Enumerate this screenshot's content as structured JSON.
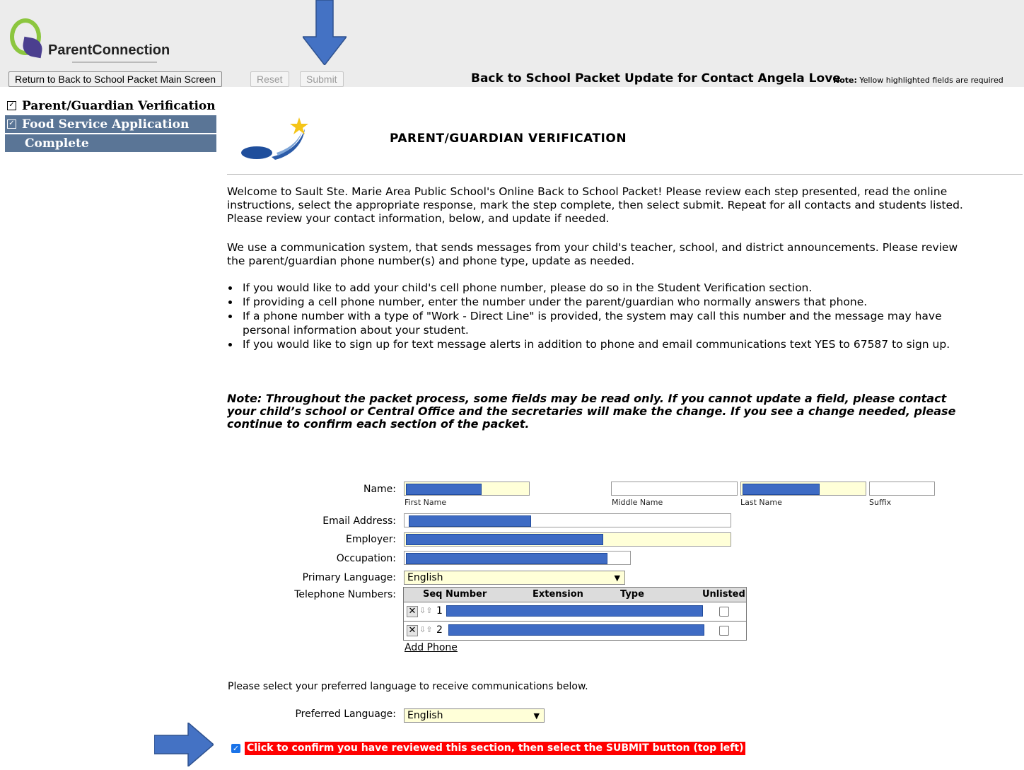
{
  "app": {
    "logo_text": "ParentConnection"
  },
  "toolbar": {
    "return_label": "Return to Back to School Packet Main Screen",
    "reset_label": "Reset",
    "submit_label": "Submit"
  },
  "header": {
    "title": "Back to School Packet Update for Contact Angela Love",
    "note_label": "Note:",
    "note_text": " Yellow highlighted fields are required"
  },
  "sidebar": {
    "items": [
      {
        "label": "Parent/Guardian Verification",
        "checked": true
      },
      {
        "label": "Food Service Application",
        "checked": true
      },
      {
        "label": "Complete",
        "checked": false
      }
    ]
  },
  "main": {
    "page_title": "PARENT/GUARDIAN VERIFICATION",
    "intro": "Welcome to Sault Ste. Marie Area Public School's Online Back to School Packet! Please review each step presented, read the online instructions, select the appropriate response, mark the step complete, then select submit. Repeat for all contacts and students listed. Please review your contact information, below, and update if needed.",
    "comm_para": "We use a communication system, that sends messages from your child's teacher, school, and district announcements. Please review the parent/guardian phone number(s) and phone type, update as needed.",
    "bullets": [
      "If you would like to add your child's cell phone number, please do so in the Student Verification section.",
      "If providing a cell phone number, enter the number under the parent/guardian who normally answers that phone.",
      "If a phone number with a type of \"Work - Direct Line\" is provided, the system may call this number and the message may have personal information about your student.",
      "If you would like to sign up for text message alerts in addition to phone and email communications text YES to 67587 to sign up."
    ],
    "note": "Note: Throughout the packet process, some fields may be read only. If you cannot update a field, please contact your child’s school or Central Office and the secretaries will make the change. If you see a change needed, please continue to confirm each section of the packet."
  },
  "form": {
    "name_label": "Name:",
    "first_name_caption": "First Name",
    "middle_name_caption": "Middle Name",
    "last_name_caption": "Last Name",
    "suffix_caption": "Suffix",
    "email_label": "Email Address:",
    "employer_label": "Employer:",
    "occupation_label": "Occupation:",
    "primary_language_label": "Primary Language:",
    "primary_language_value": "English",
    "telephone_label": "Telephone Numbers:",
    "phone_columns": [
      "Seq Number",
      "Extension",
      "Type",
      "Unlisted"
    ],
    "phone_rows": [
      {
        "seq": "1"
      },
      {
        "seq": "2"
      }
    ],
    "add_phone_label": "Add Phone",
    "pref_para": "Please select your preferred language to receive communications below.",
    "preferred_language_label": "Preferred Language:",
    "preferred_language_value": "English",
    "confirm_text": "Click to confirm you have reviewed this section, then select the SUBMIT button (top left)"
  },
  "colors": {
    "sidebar_active": "#5a7596",
    "required_field": "#ffffd8",
    "confirm_bg": "#ff0000",
    "annotation_arrow": "#4472c4"
  }
}
